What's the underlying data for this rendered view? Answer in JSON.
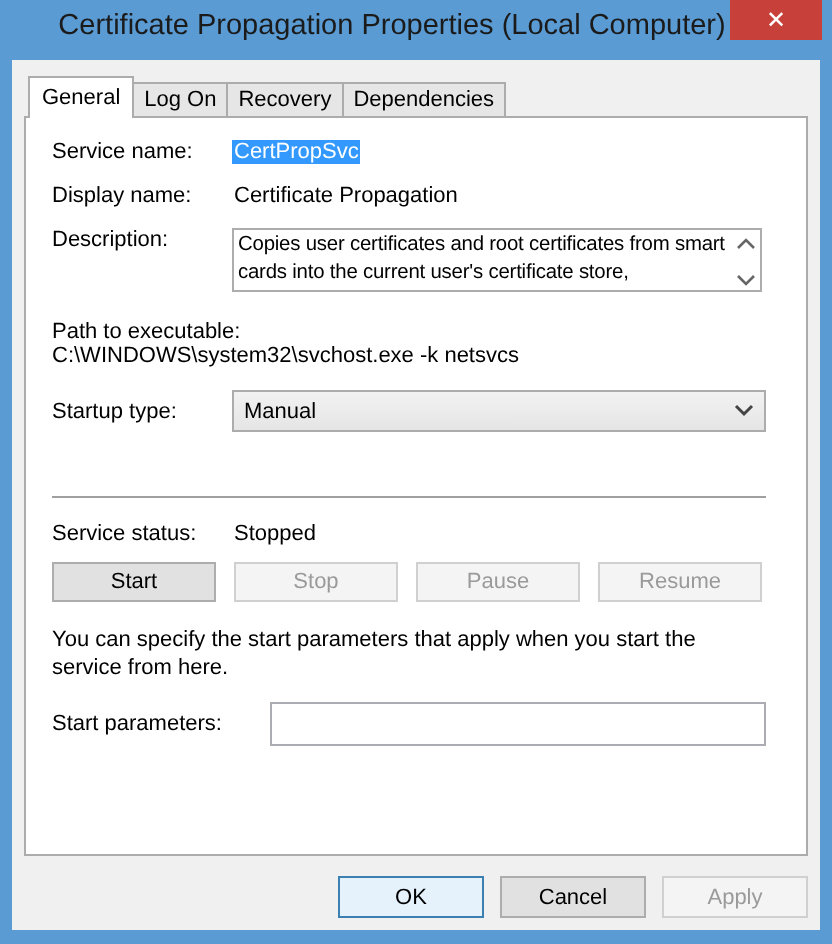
{
  "window": {
    "title": "Certificate Propagation Properties (Local Computer)",
    "close": "✕"
  },
  "tabs": [
    {
      "label": "General",
      "selected": true
    },
    {
      "label": "Log On",
      "selected": false
    },
    {
      "label": "Recovery",
      "selected": false
    },
    {
      "label": "Dependencies",
      "selected": false
    }
  ],
  "service_name": {
    "label": "Service name:",
    "value": "CertPropSvc",
    "selected": true
  },
  "display_name": {
    "label": "Display name:",
    "value": "Certificate Propagation"
  },
  "description": {
    "label": "Description:",
    "value": "Copies user certificates and root certificates from smart cards into the current user's certificate store,"
  },
  "path": {
    "label": "Path to executable:",
    "value": "C:\\WINDOWS\\system32\\svchost.exe -k netsvcs"
  },
  "startup_type": {
    "label": "Startup type:",
    "value": "Manual"
  },
  "service_status": {
    "label": "Service status:",
    "value": "Stopped"
  },
  "control_buttons": [
    {
      "label": "Start",
      "disabled": false
    },
    {
      "label": "Stop",
      "disabled": true
    },
    {
      "label": "Pause",
      "disabled": true
    },
    {
      "label": "Resume",
      "disabled": true
    }
  ],
  "hint": "You can specify the start parameters that apply when you start the service from here.",
  "start_parameters": {
    "label": "Start parameters:"
  },
  "dialog_buttons": [
    {
      "label": "OK",
      "disabled": false,
      "focused": true
    },
    {
      "label": "Cancel",
      "disabled": false,
      "focused": false
    },
    {
      "label": "Apply",
      "disabled": true,
      "focused": false
    }
  ]
}
